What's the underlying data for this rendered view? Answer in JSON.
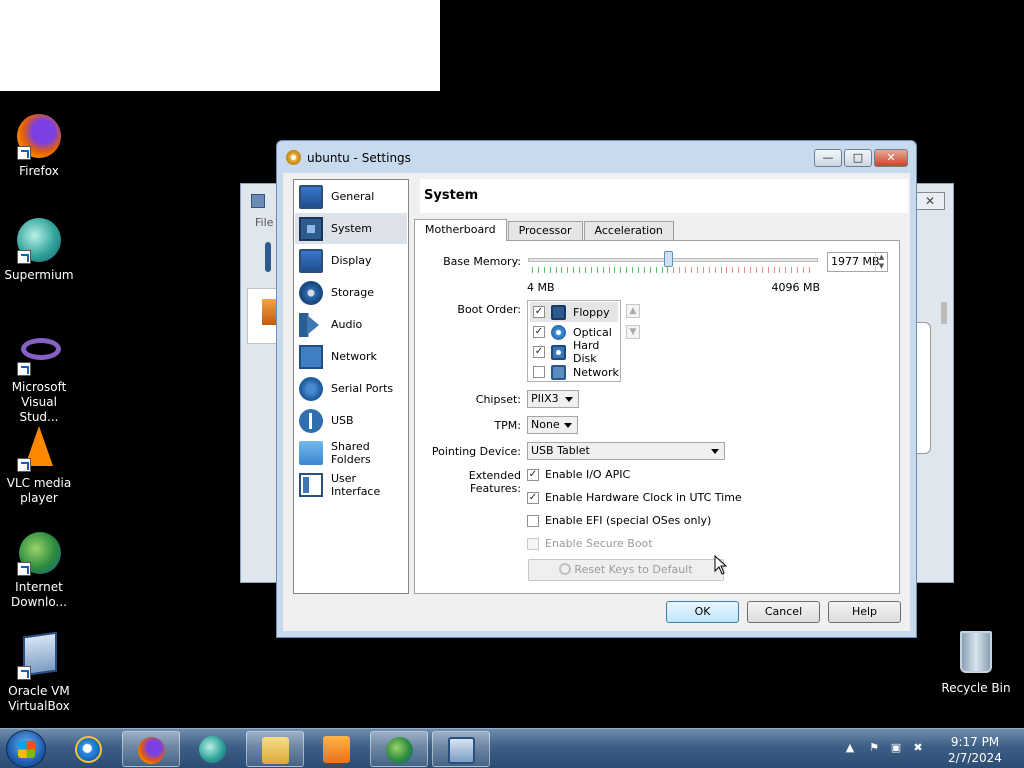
{
  "desktop": {
    "icons": [
      {
        "label": "Firefox"
      },
      {
        "label": "Supermium"
      },
      {
        "label": "Microsoft Visual Stud..."
      },
      {
        "label": "VLC media player"
      },
      {
        "label": "Internet Downlo..."
      },
      {
        "label": "Oracle VM VirtualBox"
      }
    ],
    "recycle_bin": "Recycle Bin"
  },
  "background_window": {
    "menu_file": "File",
    "close_glyph": "✕"
  },
  "dialog": {
    "title": "ubuntu - Settings",
    "sidebar": [
      {
        "label": "General",
        "icon": "monitor-icon"
      },
      {
        "label": "System",
        "icon": "chip-icon"
      },
      {
        "label": "Display",
        "icon": "monitor-icon"
      },
      {
        "label": "Storage",
        "icon": "disk-icon"
      },
      {
        "label": "Audio",
        "icon": "speaker-icon"
      },
      {
        "label": "Network",
        "icon": "network-icon"
      },
      {
        "label": "Serial Ports",
        "icon": "serial-port-icon"
      },
      {
        "label": "USB",
        "icon": "usb-icon"
      },
      {
        "label": "Shared Folders",
        "icon": "folder-icon"
      },
      {
        "label": "User Interface",
        "icon": "window-icon"
      }
    ],
    "selected_section": "System",
    "section_title": "System",
    "tabs": [
      "Motherboard",
      "Processor",
      "Acceleration"
    ],
    "active_tab": "Motherboard",
    "motherboard": {
      "base_memory_label": "Base Memory:",
      "base_memory_value": "1977 MB",
      "memory_min": "4 MB",
      "memory_max": "4096 MB",
      "memory_fraction": 0.48,
      "boot_order_label": "Boot Order:",
      "boot_devices": [
        {
          "label": "Floppy",
          "checked": true
        },
        {
          "label": "Optical",
          "checked": true
        },
        {
          "label": "Hard Disk",
          "checked": true
        },
        {
          "label": "Network",
          "checked": false
        }
      ],
      "chipset_label": "Chipset:",
      "chipset_value": "PIIX3",
      "tpm_label": "TPM:",
      "tpm_value": "None",
      "pointing_label": "Pointing Device:",
      "pointing_value": "USB Tablet",
      "extended_label": "Extended Features:",
      "features": [
        {
          "label": "Enable I/O APIC",
          "checked": true,
          "enabled": true
        },
        {
          "label": "Enable Hardware Clock in UTC Time",
          "checked": true,
          "enabled": true
        },
        {
          "label": "Enable EFI (special OSes only)",
          "checked": false,
          "enabled": true
        },
        {
          "label": "Enable Secure Boot",
          "checked": false,
          "enabled": false
        }
      ],
      "reset_keys_label": "Reset Keys to Default"
    },
    "buttons": {
      "ok": "OK",
      "cancel": "Cancel",
      "help": "Help"
    },
    "window_buttons": {
      "minimize": "—",
      "maximize": "□",
      "close": "✕"
    }
  },
  "taskbar": {
    "pinned": [
      {
        "icon": "internet-explorer-icon"
      },
      {
        "icon": "firefox-icon"
      },
      {
        "icon": "supermium-icon"
      },
      {
        "icon": "file-explorer-icon"
      },
      {
        "icon": "media-player-icon"
      },
      {
        "icon": "internet-download-manager-icon"
      },
      {
        "icon": "virtualbox-icon"
      }
    ],
    "time": "9:17 PM",
    "date": "2/7/2024"
  },
  "colors": {
    "desktop_bg": "#000000",
    "dialog_frame": "#c8daee",
    "taskbar": "#3d5f86"
  }
}
